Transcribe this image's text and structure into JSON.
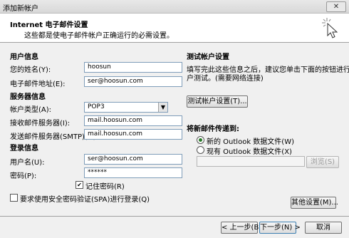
{
  "window": {
    "title": "添加新帐户",
    "close": "✕"
  },
  "header": {
    "title": "Internet 电子邮件设置",
    "desc": "这些都是使电子邮件帐户正确运行的必需设置。"
  },
  "user_info": {
    "heading": "用户信息",
    "name_label": "您的姓名(Y):",
    "name_value": "hoosun",
    "email_label": "电子邮件地址(E):",
    "email_value": "ser@hoosun.com"
  },
  "server_info": {
    "heading": "服务器信息",
    "account_type_label": "帐户类型(A):",
    "account_type_value": "POP3",
    "incoming_label": "接收邮件服务器(I):",
    "incoming_value": "mail.hoosun.com",
    "outgoing_label": "发送邮件服务器(SMTP)(O):",
    "outgoing_value": "mail.hoosun.com"
  },
  "login_info": {
    "heading": "登录信息",
    "username_label": "用户名(U):",
    "username_value": "ser@hoosun.com",
    "password_label": "密码(P):",
    "password_value": "******",
    "remember_label": "记住密码(R)",
    "remember_checked": true,
    "spa_label": "要求使用安全密码验证(SPA)进行登录(Q)",
    "spa_checked": false
  },
  "test": {
    "heading": "测试帐户设置",
    "desc_line1": "填写完此这些信息之后，建议您单击下面的按钮进行帐",
    "desc_line2": "户测试。(需要网络连接)",
    "button": "测试帐户设置(T)..."
  },
  "deliver": {
    "heading": "将新邮件传递到:",
    "new_file": "新的 Outlook 数据文件(W)",
    "existing_file": "现有 Outlook 数据文件(X)",
    "selected": "new_file",
    "browse": "浏览(S)"
  },
  "footer": {
    "more_settings": "其他设置(M)...",
    "back": "< 上一步(B)",
    "next": "下一步(N) >",
    "cancel": "取消"
  }
}
